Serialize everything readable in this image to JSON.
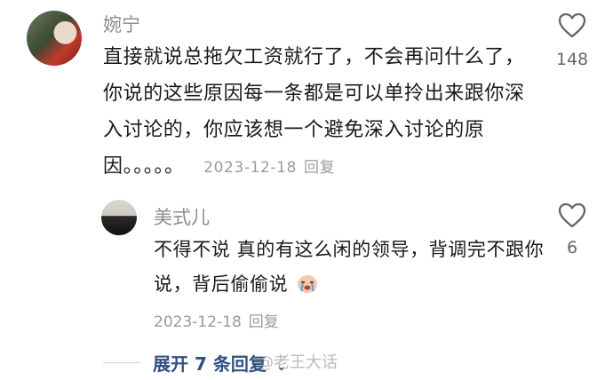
{
  "comment": {
    "username": "婉宁",
    "text": "直接就说总拖欠工资就行了，不会再问什么了，你说的这些原因每一条都是可以单拎出来跟你深入讨论的，你应该想一个避免深入讨论的原因。。。。。",
    "date": "2023-12-18",
    "reply_label": "回复",
    "like_count": "148"
  },
  "reply": {
    "username": "美式儿",
    "text": "不得不说 真的有这么闲的领导，背调完不跟你说，背后偷偷说",
    "date": "2023-12-18",
    "reply_label": "回复",
    "like_count": "6"
  },
  "expand": {
    "label": "展开 7 条回复"
  },
  "watermark": {
    "text": "@老王大话"
  },
  "icons": {
    "like": "heart-outline-icon",
    "expand": "chevron-down-icon",
    "emoji": "crying-face-icon"
  }
}
